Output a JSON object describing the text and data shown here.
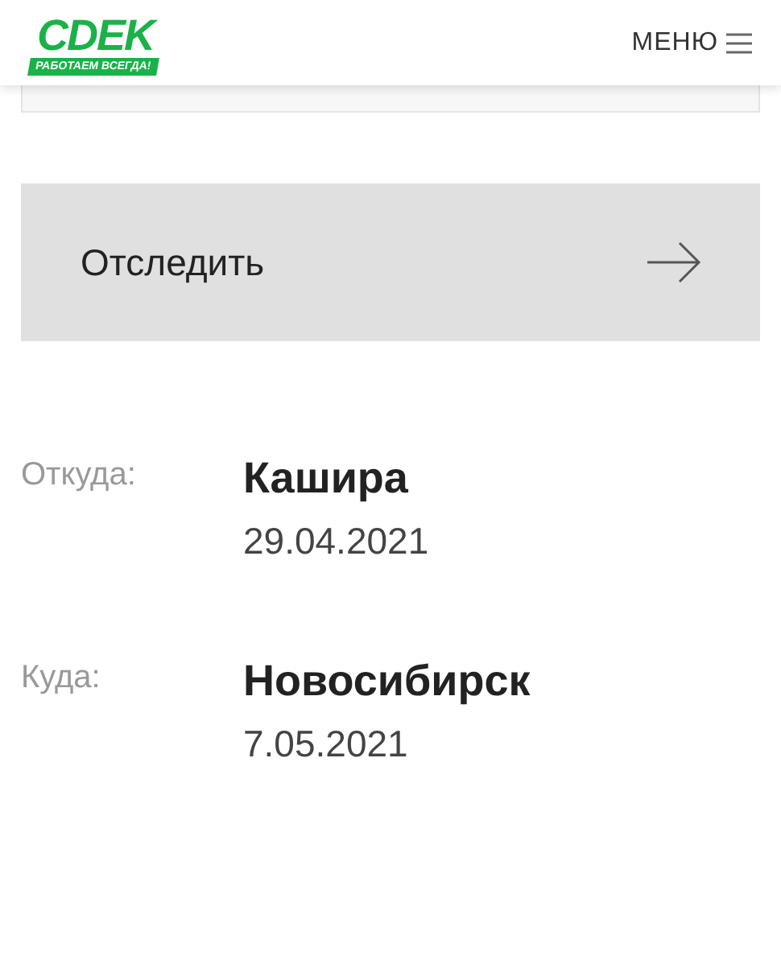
{
  "header": {
    "logo": "CDEK",
    "tagline": "РАБОТАЕМ ВСЕГДА!",
    "menu": "МЕНЮ"
  },
  "track_button": {
    "label": "Отследить"
  },
  "route": [
    {
      "label": "Откуда:",
      "city": "Кашира",
      "date": "29.04.2021"
    },
    {
      "label": "Куда:",
      "city": "Новосибирск",
      "date": "7.05.2021"
    }
  ]
}
